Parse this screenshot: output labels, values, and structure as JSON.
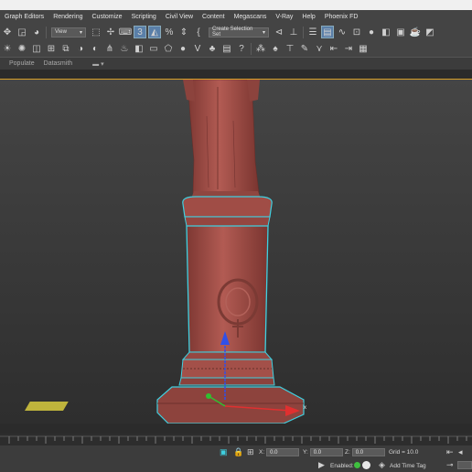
{
  "menu": [
    "Graph Editors",
    "Rendering",
    "Customize",
    "Scripting",
    "Civil View",
    "Content",
    "Megascans",
    "V-Ray",
    "Help",
    "Phoenix FD"
  ],
  "toolbar": {
    "view_dropdown": "View",
    "selection_set_dropdown": "Create Selection Set",
    "snap_label": "3"
  },
  "ribbon": {
    "tabs": [
      "Populate",
      "Datasmith"
    ]
  },
  "status": {
    "x_label": "X:",
    "x_value": "0.0",
    "y_label": "Y:",
    "y_value": "0.0",
    "z_label": "Z:",
    "z_value": "0.0",
    "grid": "Grid = 10.0",
    "enabled": "Enabled:",
    "add_time_tag": "Add Time Tag"
  },
  "colors": {
    "accent": "#5a7fa8",
    "viewport_border": "#d9a12a",
    "selection": "#3fd0e0",
    "statue": "#a8534c"
  }
}
